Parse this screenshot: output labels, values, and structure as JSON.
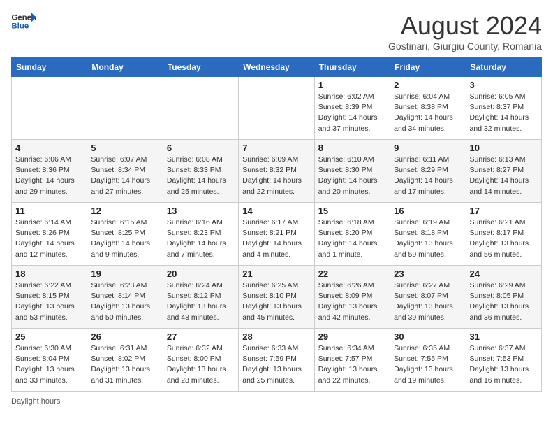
{
  "header": {
    "logo_general": "General",
    "logo_blue": "Blue",
    "month_year": "August 2024",
    "location": "Gostinari, Giurgiu County, Romania"
  },
  "calendar": {
    "days_of_week": [
      "Sunday",
      "Monday",
      "Tuesday",
      "Wednesday",
      "Thursday",
      "Friday",
      "Saturday"
    ],
    "weeks": [
      [
        {
          "day": "",
          "info": ""
        },
        {
          "day": "",
          "info": ""
        },
        {
          "day": "",
          "info": ""
        },
        {
          "day": "",
          "info": ""
        },
        {
          "day": "1",
          "info": "Sunrise: 6:02 AM\nSunset: 8:39 PM\nDaylight: 14 hours\nand 37 minutes."
        },
        {
          "day": "2",
          "info": "Sunrise: 6:04 AM\nSunset: 8:38 PM\nDaylight: 14 hours\nand 34 minutes."
        },
        {
          "day": "3",
          "info": "Sunrise: 6:05 AM\nSunset: 8:37 PM\nDaylight: 14 hours\nand 32 minutes."
        }
      ],
      [
        {
          "day": "4",
          "info": "Sunrise: 6:06 AM\nSunset: 8:36 PM\nDaylight: 14 hours\nand 29 minutes."
        },
        {
          "day": "5",
          "info": "Sunrise: 6:07 AM\nSunset: 8:34 PM\nDaylight: 14 hours\nand 27 minutes."
        },
        {
          "day": "6",
          "info": "Sunrise: 6:08 AM\nSunset: 8:33 PM\nDaylight: 14 hours\nand 25 minutes."
        },
        {
          "day": "7",
          "info": "Sunrise: 6:09 AM\nSunset: 8:32 PM\nDaylight: 14 hours\nand 22 minutes."
        },
        {
          "day": "8",
          "info": "Sunrise: 6:10 AM\nSunset: 8:30 PM\nDaylight: 14 hours\nand 20 minutes."
        },
        {
          "day": "9",
          "info": "Sunrise: 6:11 AM\nSunset: 8:29 PM\nDaylight: 14 hours\nand 17 minutes."
        },
        {
          "day": "10",
          "info": "Sunrise: 6:13 AM\nSunset: 8:27 PM\nDaylight: 14 hours\nand 14 minutes."
        }
      ],
      [
        {
          "day": "11",
          "info": "Sunrise: 6:14 AM\nSunset: 8:26 PM\nDaylight: 14 hours\nand 12 minutes."
        },
        {
          "day": "12",
          "info": "Sunrise: 6:15 AM\nSunset: 8:25 PM\nDaylight: 14 hours\nand 9 minutes."
        },
        {
          "day": "13",
          "info": "Sunrise: 6:16 AM\nSunset: 8:23 PM\nDaylight: 14 hours\nand 7 minutes."
        },
        {
          "day": "14",
          "info": "Sunrise: 6:17 AM\nSunset: 8:21 PM\nDaylight: 14 hours\nand 4 minutes."
        },
        {
          "day": "15",
          "info": "Sunrise: 6:18 AM\nSunset: 8:20 PM\nDaylight: 14 hours\nand 1 minute."
        },
        {
          "day": "16",
          "info": "Sunrise: 6:19 AM\nSunset: 8:18 PM\nDaylight: 13 hours\nand 59 minutes."
        },
        {
          "day": "17",
          "info": "Sunrise: 6:21 AM\nSunset: 8:17 PM\nDaylight: 13 hours\nand 56 minutes."
        }
      ],
      [
        {
          "day": "18",
          "info": "Sunrise: 6:22 AM\nSunset: 8:15 PM\nDaylight: 13 hours\nand 53 minutes."
        },
        {
          "day": "19",
          "info": "Sunrise: 6:23 AM\nSunset: 8:14 PM\nDaylight: 13 hours\nand 50 minutes."
        },
        {
          "day": "20",
          "info": "Sunrise: 6:24 AM\nSunset: 8:12 PM\nDaylight: 13 hours\nand 48 minutes."
        },
        {
          "day": "21",
          "info": "Sunrise: 6:25 AM\nSunset: 8:10 PM\nDaylight: 13 hours\nand 45 minutes."
        },
        {
          "day": "22",
          "info": "Sunrise: 6:26 AM\nSunset: 8:09 PM\nDaylight: 13 hours\nand 42 minutes."
        },
        {
          "day": "23",
          "info": "Sunrise: 6:27 AM\nSunset: 8:07 PM\nDaylight: 13 hours\nand 39 minutes."
        },
        {
          "day": "24",
          "info": "Sunrise: 6:29 AM\nSunset: 8:05 PM\nDaylight: 13 hours\nand 36 minutes."
        }
      ],
      [
        {
          "day": "25",
          "info": "Sunrise: 6:30 AM\nSunset: 8:04 PM\nDaylight: 13 hours\nand 33 minutes."
        },
        {
          "day": "26",
          "info": "Sunrise: 6:31 AM\nSunset: 8:02 PM\nDaylight: 13 hours\nand 31 minutes."
        },
        {
          "day": "27",
          "info": "Sunrise: 6:32 AM\nSunset: 8:00 PM\nDaylight: 13 hours\nand 28 minutes."
        },
        {
          "day": "28",
          "info": "Sunrise: 6:33 AM\nSunset: 7:59 PM\nDaylight: 13 hours\nand 25 minutes."
        },
        {
          "day": "29",
          "info": "Sunrise: 6:34 AM\nSunset: 7:57 PM\nDaylight: 13 hours\nand 22 minutes."
        },
        {
          "day": "30",
          "info": "Sunrise: 6:35 AM\nSunset: 7:55 PM\nDaylight: 13 hours\nand 19 minutes."
        },
        {
          "day": "31",
          "info": "Sunrise: 6:37 AM\nSunset: 7:53 PM\nDaylight: 13 hours\nand 16 minutes."
        }
      ]
    ]
  },
  "footer": {
    "daylight_note": "Daylight hours"
  }
}
